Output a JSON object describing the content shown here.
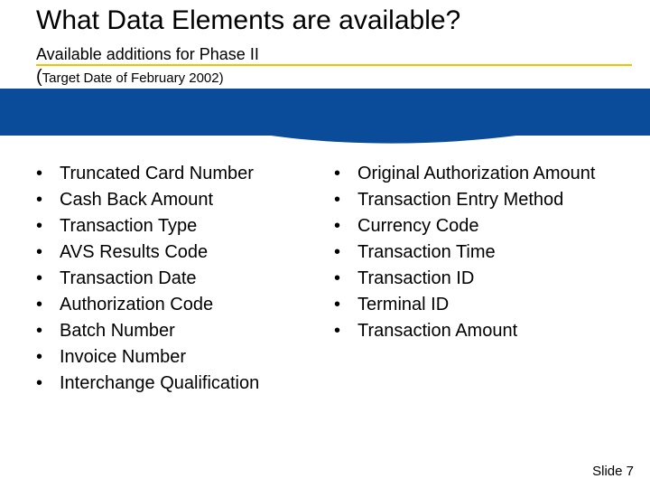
{
  "title": "What Data Elements are available?",
  "subtitle_line1": "Available additions for Phase II",
  "subtitle_line2_inner": "Target Date of February 2002)",
  "left_items": [
    "Truncated Card Number",
    "Cash Back Amount",
    "Transaction Type",
    "AVS Results Code",
    "Transaction Date",
    "Authorization Code",
    "Batch Number",
    "Invoice Number",
    "Interchange Qualification"
  ],
  "right_items": [
    "Original Authorization Amount",
    "Transaction Entry Method",
    "Currency Code",
    "Transaction Time",
    "Transaction ID",
    "Terminal ID",
    "Transaction Amount"
  ],
  "footer": "Slide 7",
  "bullet_char": "•",
  "open_paren": "("
}
